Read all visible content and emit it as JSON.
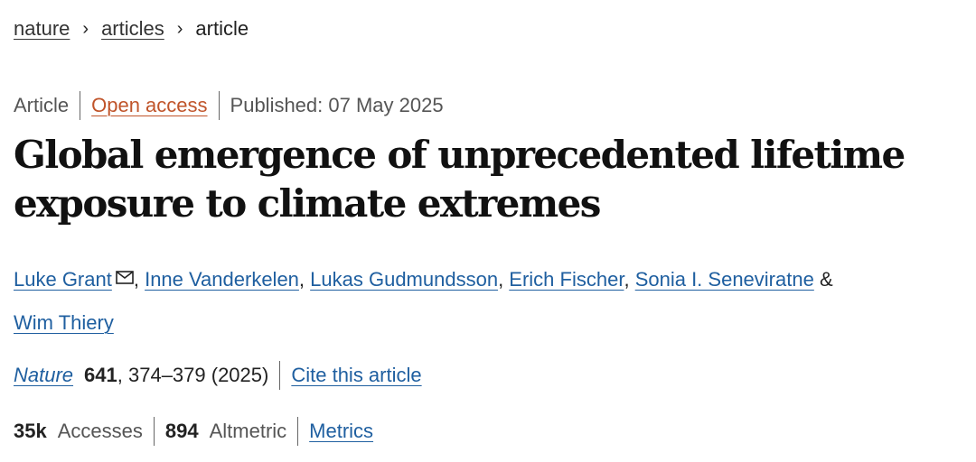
{
  "breadcrumb": {
    "items": [
      {
        "label": "nature"
      },
      {
        "label": "articles"
      }
    ],
    "current": "article",
    "separator": "›"
  },
  "meta": {
    "type": "Article",
    "access": "Open access",
    "published": "Published: 07 May 2025"
  },
  "article": {
    "title": "Global emergence of unprecedented lifetime exposure to climate extremes"
  },
  "authors": {
    "list": [
      {
        "name": "Luke Grant",
        "separator": ", "
      },
      {
        "name": "Inne Vanderkelen",
        "separator": ", "
      },
      {
        "name": "Lukas Gudmundsson",
        "separator": ", "
      },
      {
        "name": "Erich Fischer",
        "separator": ", "
      },
      {
        "name": "Sonia I. Seneviratne",
        "separator": " & "
      },
      {
        "name": "Wim Thiery",
        "separator": ""
      }
    ],
    "corresponding_icon": "mail-icon"
  },
  "citation": {
    "journal": "Nature",
    "volume": "641",
    "pages_year": ", 374–379 (2025)",
    "cite_label": "Cite this article"
  },
  "metrics": {
    "accesses_value": "35k",
    "accesses_label": "Accesses",
    "altmetric_value": "894",
    "altmetric_label": "Altmetric",
    "metrics_link": "Metrics"
  },
  "colors": {
    "link": "#1f5fa0",
    "open_access": "#c0542a",
    "text": "#222222",
    "muted": "#555555"
  }
}
